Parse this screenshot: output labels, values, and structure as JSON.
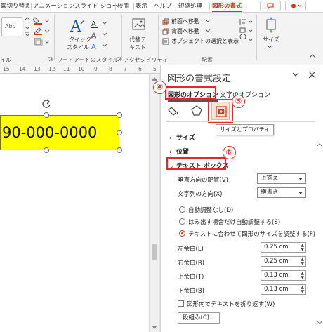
{
  "ribbon_tabs": [
    "図切り替え",
    "アニメーション",
    "スライド ショー",
    "校閲",
    "表示",
    "ヘルプ",
    "短縮処理",
    "図形の書式"
  ],
  "ribbon": {
    "style_preview": "Abc",
    "quick_style_label": "クイック",
    "quick_style_label2": "スタイル",
    "alt_text_label": "代替テ",
    "alt_text_label2": "キスト",
    "bring_forward": "前面へ移動",
    "send_backward": "背面へ移動",
    "selection_pane": "オブジェクトの選択と表示",
    "size_label": "サイズ",
    "group_style": "イル",
    "group_wordart": "ワードアートのスタイル",
    "group_accessibility": "アクセシビリティ",
    "group_arrange": "配置"
  },
  "ruler_marks": [
    "15",
    "14",
    "13",
    "12",
    "11",
    "10",
    "9",
    "8",
    "7",
    "6",
    "5"
  ],
  "slide": {
    "shape_text": "90-000-0000",
    "shape_color": "#ffff00"
  },
  "pane": {
    "title": "図形の書式設定",
    "tab_shape_options": "図形のオプション",
    "tab_text_options": "文字のオプション",
    "tooltip": "サイズとプロパティ",
    "section_size": "サイズ",
    "section_position": "位置",
    "section_textbox": "テキスト ボックス",
    "vertical_align_label": "垂直方向の配置(V)",
    "vertical_align_value": "上揃え",
    "text_direction_label": "文字列の方向(X)",
    "text_direction_value": "横書き",
    "radio_no_autofit": "自動調整なし(D)",
    "radio_shrink": "はみ出す場合だけ自動調整する(S)",
    "radio_resize_shape": "テキストに合わせて図形のサイズを調整する(F)",
    "margin_left_label": "左余白(L)",
    "margin_left_value": "0.25 cm",
    "margin_right_label": "右余白(R)",
    "margin_right_value": "0.25 cm",
    "margin_top_label": "上余白(T)",
    "margin_top_value": "0.13 cm",
    "margin_bottom_label": "下余白(B)",
    "margin_bottom_value": "0.13 cm",
    "wrap_text_label": "図形内でテキストを折り返す(W)",
    "columns_button": "段組み(C)..."
  },
  "annotations": {
    "n4": "④",
    "n5": "⑤",
    "n6": "⑥"
  },
  "colors": {
    "accent": "#c43e1c",
    "annotation_red": "#e8262a"
  }
}
